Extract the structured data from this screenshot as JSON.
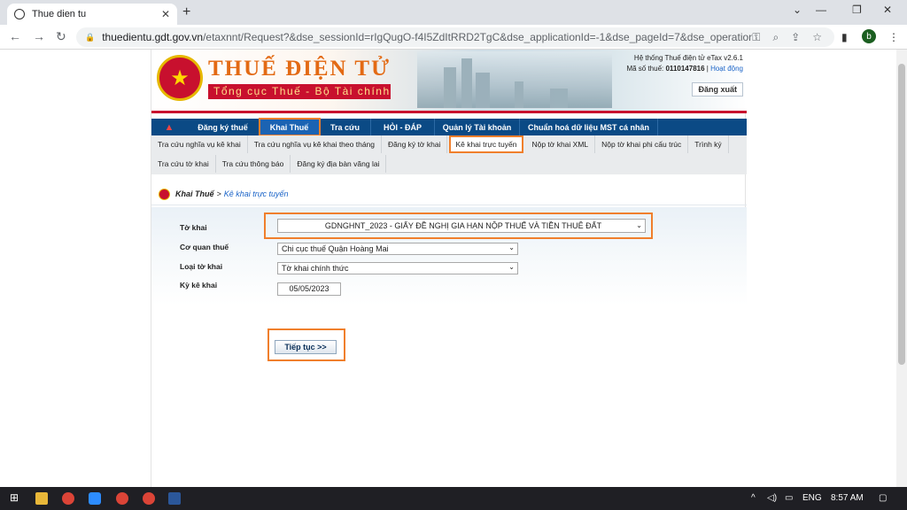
{
  "browser": {
    "tab_title": "Thue dien tu",
    "url_host": "thuedientu.gdt.gov.vn",
    "url_path": "/etaxnnt/Request?&dse_sessionId=rIgQugO-f4I5ZdItRRD2TgC&dse_applicationId=-1&dse_pageId=7&dse_operationNam...",
    "profile_initial": "b"
  },
  "header": {
    "brand": "THUẾ ĐIỆN TỬ",
    "subtitle": "Tổng cục Thuế - Bộ Tài chính",
    "system_version": "Hệ thống Thuế điện tử eTax v2.6.1",
    "tax_id_label": "Mã số thuế:",
    "tax_id": "0110147816",
    "activity_link": "Hoạt động",
    "logout": "Đăng xuất"
  },
  "mainnav": [
    {
      "label": "Đăng ký thuế"
    },
    {
      "label": "Khai Thuế"
    },
    {
      "label": "Tra cứu"
    },
    {
      "label": "HỎI - ĐÁP"
    },
    {
      "label": "Quản lý Tài khoản"
    },
    {
      "label": "Chuẩn hoá dữ liệu MST cá nhân"
    }
  ],
  "subnav": [
    {
      "label": "Tra cứu nghĩa vụ kê khai"
    },
    {
      "label": "Tra cứu nghĩa vụ kê khai theo tháng"
    },
    {
      "label": "Đăng ký tờ khai"
    },
    {
      "label": "Kê khai trực tuyến"
    },
    {
      "label": "Nộp tờ khai XML"
    },
    {
      "label": "Nộp tờ khai phi cấu trúc"
    },
    {
      "label": "Trình ký"
    },
    {
      "label": "Tra cứu tờ khai"
    },
    {
      "label": "Tra cứu thông báo"
    },
    {
      "label": "Đăng ký địa bàn vãng lai"
    }
  ],
  "breadcrumb": {
    "parent": "Khai Thuế",
    "separator": ">",
    "current": "Kê khai trực tuyến"
  },
  "form": {
    "to_khai_label": "Tờ khai",
    "to_khai_value": "GDNGHNT_2023 - GIẤY ĐỀ NGHỊ GIA HẠN NỘP THUẾ VÀ TIỀN THUÊ ĐẤT",
    "co_quan_label": "Cơ quan thuế",
    "co_quan_value": "Chi cục thuế Quận Hoàng Mai",
    "loai_label": "Loại tờ khai",
    "loai_value": "Tờ khai chính thức",
    "ky_label": "Kỳ kê khai",
    "ky_value": "05/05/2023",
    "continue_button": "Tiếp tục >>"
  },
  "taskbar": {
    "language": "ENG",
    "time": "8:57 AM"
  },
  "colors": {
    "nav_blue": "#0b4a85",
    "highlight_orange": "#f07f2c",
    "brand_orange": "#e36a14",
    "brand_red": "#c8102e"
  }
}
